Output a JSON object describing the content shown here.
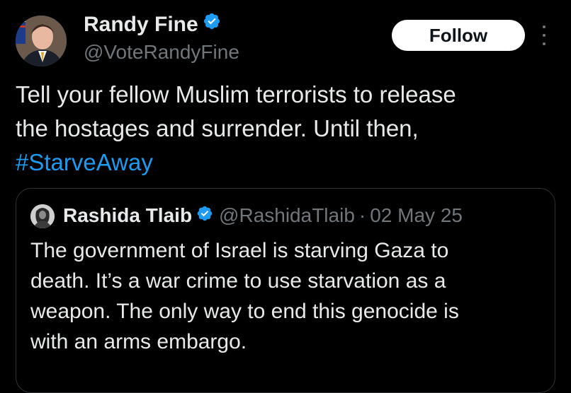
{
  "post": {
    "author_name": "Randy Fine",
    "author_handle": "@VoteRandyFine",
    "verified": true,
    "text": "Tell your fellow Muslim terrorists to release\nthe hostages and surrender.  Until then,\n",
    "hashtag": "#StarveAway",
    "follow_label": "Follow",
    "more_icon": "more-vertical-icon"
  },
  "quote": {
    "author_name": "Rashida Tlaib",
    "author_handle": "@RashidaTlaib",
    "separator": "·",
    "date": "02 May 25",
    "verified": true,
    "text": "The government of Israel is starving  Gaza to\ndeath. It’s a war crime to use starvation as a\nweapon. The only way to end this genocide is\nwith an arms embargo."
  },
  "colors": {
    "background": "#000000",
    "text": "#e7e9ea",
    "secondary": "#71767b",
    "accent": "#1d9bf0",
    "border": "#2f3336"
  }
}
